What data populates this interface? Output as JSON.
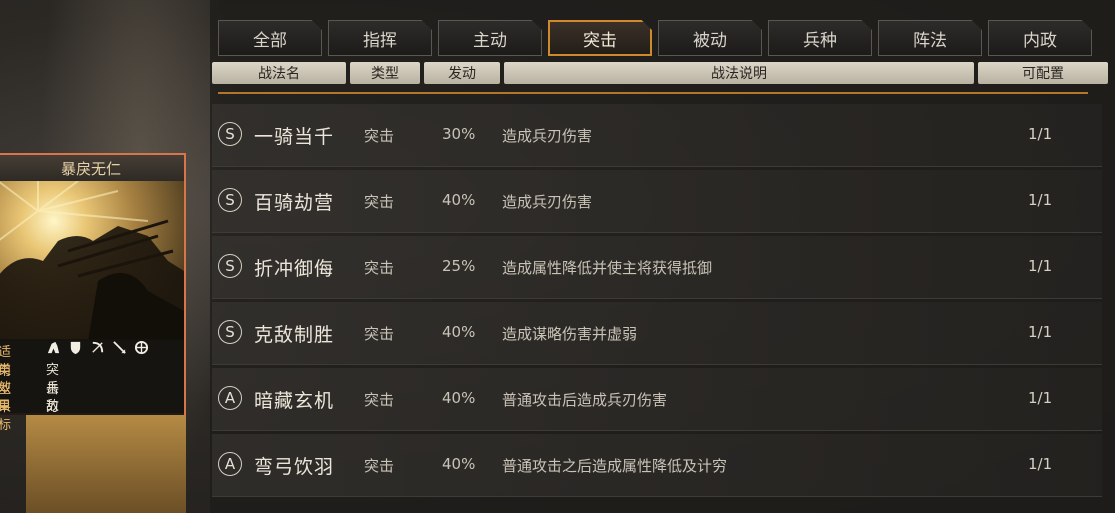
{
  "tabs": [
    {
      "label": "全部"
    },
    {
      "label": "指挥"
    },
    {
      "label": "主动"
    },
    {
      "label": "突击",
      "active": true
    },
    {
      "label": "被动"
    },
    {
      "label": "兵种"
    },
    {
      "label": "阵法"
    },
    {
      "label": "内政"
    }
  ],
  "columns": {
    "name": "战法名",
    "type": "类型",
    "rate": "发动",
    "desc": "战法说明",
    "count": "可配置"
  },
  "rows": [
    {
      "grade": "S",
      "name": "一骑当千",
      "type": "突击",
      "rate": "30%",
      "desc": "造成兵刃伤害",
      "count": "1/1"
    },
    {
      "grade": "S",
      "name": "百骑劫营",
      "type": "突击",
      "rate": "40%",
      "desc": "造成兵刃伤害",
      "count": "1/1"
    },
    {
      "grade": "S",
      "name": "折冲御侮",
      "type": "突击",
      "rate": "25%",
      "desc": "造成属性降低并使主将获得抵御",
      "count": "1/1"
    },
    {
      "grade": "S",
      "name": "克敌制胜",
      "type": "突击",
      "rate": "40%",
      "desc": "造成谋略伤害并虚弱",
      "count": "1/1"
    },
    {
      "grade": "A",
      "name": "暗藏玄机",
      "type": "突击",
      "rate": "40%",
      "desc": "普通攻击后造成兵刃伤害",
      "count": "1/1"
    },
    {
      "grade": "A",
      "name": "弯弓饮羽",
      "type": "突击",
      "rate": "40%",
      "desc": "普通攻击之后造成属性降低及计穷",
      "count": "1/1"
    }
  ],
  "card": {
    "title": "暴戾无仁",
    "applies_label": "适用",
    "applies_icons": [
      "cavalry-icon",
      "shield-icon",
      "bow-icon",
      "spear-icon",
      "wheel-icon"
    ],
    "type_label": "类型",
    "type_value": "突击",
    "effect_label": "效果",
    "effect_value": "兵刃单体",
    "target_label": "目标",
    "target_value": "敌军单体"
  },
  "colors": {
    "accent": "#d08a2e",
    "card_border": "#d9754a",
    "header_bg": "#c9c2b2"
  }
}
